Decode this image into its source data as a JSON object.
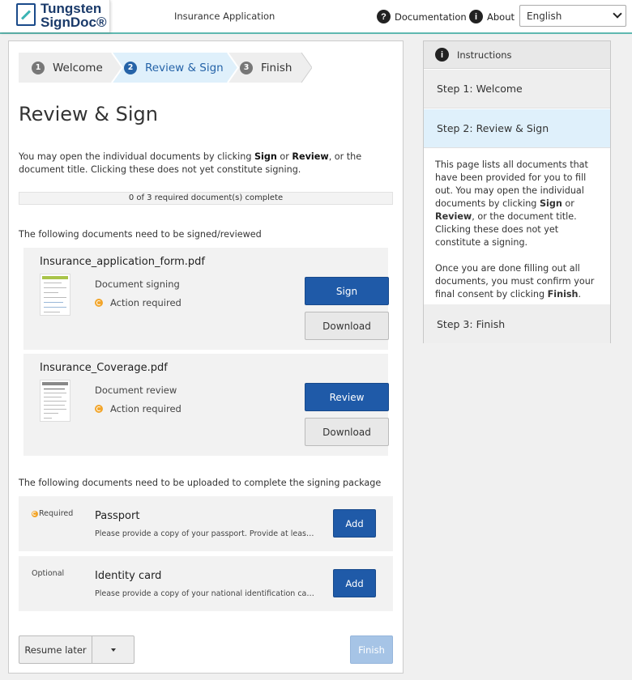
{
  "header": {
    "logo_line1": "Tungsten",
    "logo_line2": "SignDoc®",
    "app_title": "Insurance Application",
    "documentation_label": "Documentation",
    "about_label": "About",
    "language": "English"
  },
  "stepper": {
    "steps": [
      {
        "num": "1",
        "label": "Welcome"
      },
      {
        "num": "2",
        "label": "Review & Sign"
      },
      {
        "num": "3",
        "label": "Finish"
      }
    ]
  },
  "page": {
    "title": "Review & Sign",
    "intro_a": "You may open the individual documents by clicking ",
    "intro_sign": "Sign",
    "intro_or": " or ",
    "intro_review": "Review",
    "intro_b": ", or the document title. Clicking these does not yet constitute signing.",
    "progress_text": "0 of 3 required document(s) complete",
    "sign_section_label": "The following documents need to be signed/reviewed",
    "upload_section_label": "The following documents need to be uploaded to complete the signing package"
  },
  "documents": [
    {
      "name": "Insurance_application_form.pdf",
      "type": "Document signing",
      "status": "Action required",
      "action": "Sign",
      "download": "Download"
    },
    {
      "name": "Insurance_Coverage.pdf",
      "type": "Document review",
      "status": "Action required",
      "action": "Review",
      "download": "Download"
    }
  ],
  "uploads": [
    {
      "requirement": "Required",
      "title": "Passport",
      "description": "Please provide a copy of your passport. Provide at least the information page",
      "action": "Add"
    },
    {
      "requirement": "Optional",
      "title": "Identity card",
      "description": "Please provide a copy of your national identification card. The front and back",
      "action": "Add"
    }
  ],
  "footer": {
    "resume_label": "Resume later",
    "finish_label": "Finish"
  },
  "instructions": {
    "title": "Instructions",
    "step1": "Step 1: Welcome",
    "step2": "Step 2: Review & Sign",
    "step3": "Step 3: Finish",
    "p1_a": "This page lists all documents that have been provided for you to fill out. You may open the individual documents by clicking ",
    "p1_sign": "Sign",
    "p1_or": " or ",
    "p1_review": "Review",
    "p1_b": ", or the document title. Clicking these does not yet constitute a signing.",
    "p2_a": "Once you are done filling out all documents, you must confirm your final consent by clicking ",
    "p2_finish": "Finish",
    "p2_b": "."
  },
  "colors": {
    "primary": "#1f5aa8",
    "accent": "#5fb8b0",
    "warning": "#f2a52a",
    "active_step_bg": "#dff0fb"
  }
}
